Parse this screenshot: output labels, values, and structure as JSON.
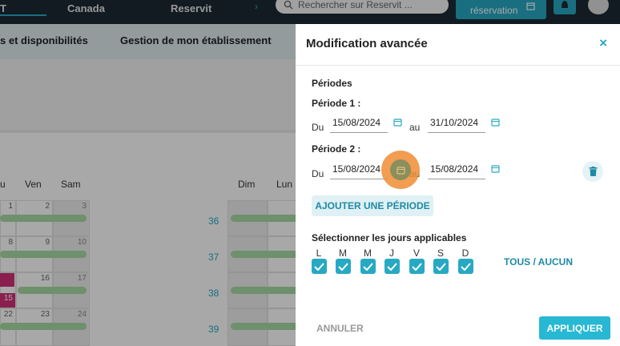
{
  "topbar": {
    "nav_active": "T",
    "nav_canada": "Canada",
    "nav_reservit": "Reservit",
    "search_placeholder": "Rechercher sur Reservit ...",
    "reserve_label": "réservation"
  },
  "subnav": {
    "item1": "s et disponibilités",
    "item2": "Gestion de mon établissement"
  },
  "calendar": {
    "left_headers": [
      "u",
      "Ven",
      "Sam"
    ],
    "right_headers": [
      "Dim",
      "Lun"
    ],
    "week_numbers": [
      "36",
      "37",
      "38",
      "39"
    ],
    "rows": [
      [
        "1",
        "2",
        "3"
      ],
      [
        "8",
        "9",
        "10"
      ],
      [
        "15",
        "16",
        "17"
      ],
      [
        "22",
        "23",
        "24"
      ]
    ]
  },
  "panel": {
    "title": "Modification avancée",
    "close": "×",
    "periods_title": "Périodes",
    "period1_label": "Période 1 :",
    "period2_label": "Période 2 :",
    "du": "Du",
    "au": "au",
    "period1_from": "15/08/2024",
    "period1_to": "31/10/2024",
    "period2_from": "15/08/2024",
    "period2_to": "15/08/2024",
    "add_period": "AJOUTER UNE PÉRIODE",
    "days_title": "Sélectionner les jours applicables",
    "days": [
      "L",
      "M",
      "M",
      "J",
      "V",
      "S",
      "D"
    ],
    "days_checked": [
      true,
      true,
      true,
      true,
      true,
      true,
      true
    ],
    "tous_aucun": "TOUS / AUCUN",
    "cancel": "ANNULER",
    "apply": "APPLIQUER"
  },
  "colors": {
    "accent": "#27a9c3",
    "available": "#a7dba4",
    "booked": "#d22f79",
    "topbar": "#1c2a35",
    "click_highlight": "#f08c32"
  }
}
